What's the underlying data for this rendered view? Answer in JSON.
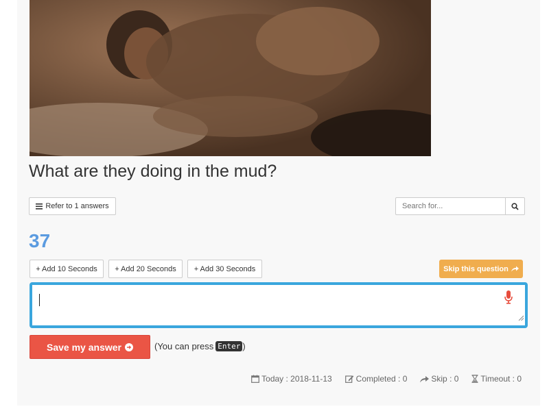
{
  "question": {
    "text": "What are they doing in the mud?"
  },
  "refer": {
    "label": "Refer to 1 answers",
    "icon": "list-icon"
  },
  "search": {
    "placeholder": "Search for..."
  },
  "timer": {
    "value": "37"
  },
  "time_buttons": [
    {
      "label": "+ Add 10 Seconds"
    },
    {
      "label": "+ Add 20 Seconds"
    },
    {
      "label": "+ Add 30 Seconds"
    }
  ],
  "skip": {
    "label": "Skip this question"
  },
  "answer": {
    "value": ""
  },
  "save": {
    "label": "Save my answer"
  },
  "hint": {
    "prefix": "(You can press ",
    "key": "Enter",
    "suffix": ")"
  },
  "stats": {
    "today": "Today : 2018-11-13",
    "completed": "Completed : 0",
    "skip": "Skip : 0",
    "timeout": "Timeout : 0"
  },
  "colors": {
    "timer": "#5b9be0",
    "skip_button": "#f0ad4e",
    "save_button": "#ea5545",
    "answer_border": "#3aa6dd",
    "mic": "#e74c3c"
  }
}
